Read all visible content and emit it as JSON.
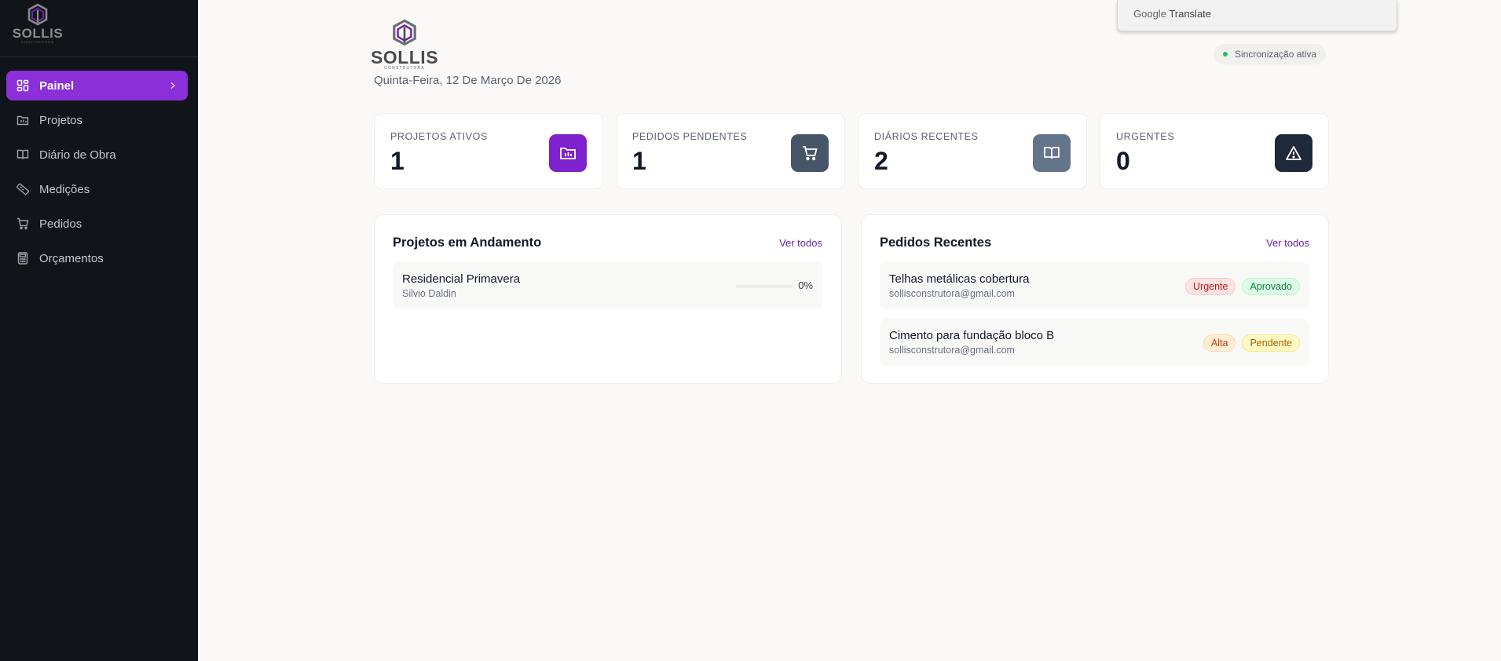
{
  "brand": {
    "name": "SOLLIS",
    "tagline": "CONSTRUTORA"
  },
  "sidebar": {
    "items": [
      {
        "label": "Painel",
        "icon": "dashboard-icon",
        "active": true
      },
      {
        "label": "Projetos",
        "icon": "folder-icon"
      },
      {
        "label": "Diário de Obra",
        "icon": "book-icon"
      },
      {
        "label": "Medições",
        "icon": "ruler-icon"
      },
      {
        "label": "Pedidos",
        "icon": "cart-icon"
      },
      {
        "label": "Orçamentos",
        "icon": "calculator-icon"
      }
    ]
  },
  "header": {
    "date": "Quinta-Feira, 12 De Março De 2026",
    "translate": {
      "brand": "Google",
      "label": "Translate"
    },
    "sync_status": "Sincronização ativa"
  },
  "stats": [
    {
      "label": "PROJETOS ATIVOS",
      "value": "1",
      "icon": "folder-chart-icon",
      "color": "#7e22ce"
    },
    {
      "label": "PEDIDOS PENDENTES",
      "value": "1",
      "icon": "cart-icon",
      "color": "#475569"
    },
    {
      "label": "DIÁRIOS RECENTES",
      "value": "2",
      "icon": "book-open-icon",
      "color": "#64748b"
    },
    {
      "label": "URGENTES",
      "value": "0",
      "icon": "alert-triangle-icon",
      "color": "#1e293b"
    }
  ],
  "projects": {
    "title": "Projetos em Andamento",
    "link": "Ver todos",
    "items": [
      {
        "name": "Residencial Primavera",
        "owner": "Silvio Daldin",
        "progress": 0,
        "progress_label": "0%"
      }
    ]
  },
  "orders": {
    "title": "Pedidos Recentes",
    "link": "Ver todos",
    "items": [
      {
        "name": "Telhas metálicas cobertura",
        "email": "sollisconstrutora@gmail.com",
        "priority": "Urgente",
        "status": "Aprovado"
      },
      {
        "name": "Cimento para fundação bloco B",
        "email": "sollisconstrutora@gmail.com",
        "priority": "Alta",
        "status": "Pendente"
      }
    ]
  },
  "colors": {
    "accent": "#8b2fd9",
    "sidebar_bg": "#111418",
    "page_bg": "#faf9f7"
  }
}
